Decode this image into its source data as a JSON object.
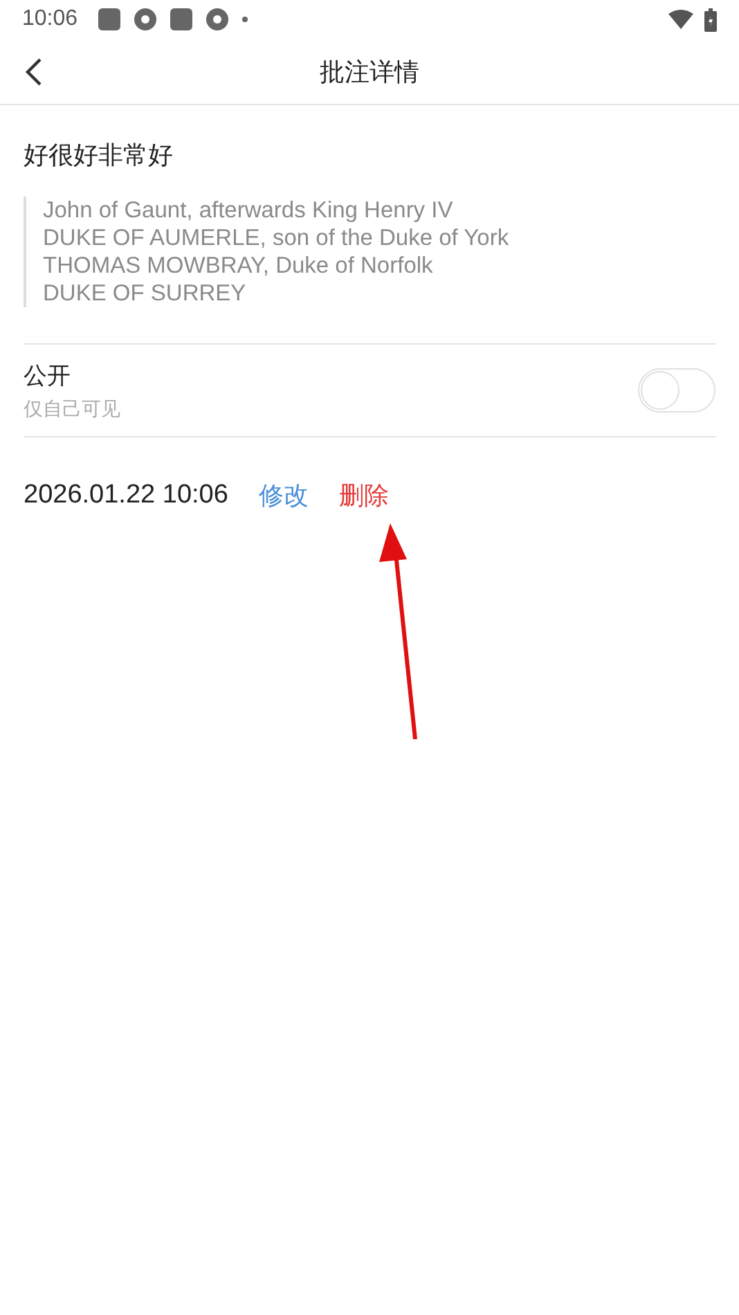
{
  "status_bar": {
    "time": "10:06"
  },
  "header": {
    "title": "批注详情"
  },
  "note": {
    "text": "好很好非常好",
    "quote": [
      "John of Gaunt, afterwards King Henry IV",
      "DUKE OF AUMERLE, son of the Duke of York",
      "THOMAS MOWBRAY, Duke of Norfolk",
      "DUKE OF SURREY"
    ]
  },
  "visibility": {
    "label": "公开",
    "hint": "仅自己可见",
    "on": false
  },
  "meta": {
    "date": "2026.01.22 10:06",
    "actions": [
      {
        "label": "修改",
        "kind": "edit"
      },
      {
        "label": "删除",
        "kind": "delete"
      }
    ]
  }
}
